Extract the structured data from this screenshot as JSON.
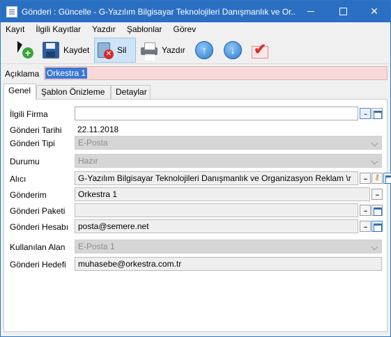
{
  "window": {
    "title": "Gönderi : Güncelle - G-Yazılım Bilgisayar Teknolojileri Danışmanlık ve Or..."
  },
  "menu": [
    "Kayıt",
    "İlgili Kayıtlar",
    "Yazdır",
    "Şablonlar",
    "Görev"
  ],
  "toolbar": {
    "save_label": "Kaydet",
    "delete_label": "Sil",
    "print_label": "Yazdır"
  },
  "description": {
    "label": "Açıklama",
    "value": "Orkestra 1"
  },
  "tabs": [
    "Genel",
    "Şablon Önizleme",
    "Detaylar"
  ],
  "form": {
    "related_company": {
      "label": "İlgili Firma",
      "value": ""
    },
    "send_date": {
      "label": "Gönderi Tarihi",
      "value": "22.11.2018"
    },
    "send_type": {
      "label": "Gönderi Tipi",
      "value": "E-Posta"
    },
    "status": {
      "label": "Durumu",
      "value": "Hazır"
    },
    "recipient": {
      "label": "Alıcı",
      "value": "G-Yazılım Bilgisayar Teknolojileri Danışmanlık ve Organizasyon Reklam  \\r"
    },
    "send": {
      "label": "Gönderim",
      "value": "Orkestra 1"
    },
    "package": {
      "label": "Gönderi Paketi",
      "value": ""
    },
    "account": {
      "label": "Gönderi Hesabı",
      "value": "posta@semere.net"
    },
    "used_field": {
      "label": "Kullanılan Alan",
      "value": "E-Posta 1"
    },
    "target": {
      "label": "Gönderi Hedefi",
      "value": "muhasebe@orkestra.com.tr"
    }
  },
  "icons": {
    "new": "new-record-icon",
    "save": "save-icon",
    "delete": "delete-icon",
    "print": "print-icon",
    "up": "arrow-up-icon",
    "down": "arrow-down-icon",
    "approve": "approve-check-icon"
  },
  "colors": {
    "titlebar": "#2b6fc2",
    "description_bg": "#f8d9d9",
    "selection": "#3a78d4"
  }
}
